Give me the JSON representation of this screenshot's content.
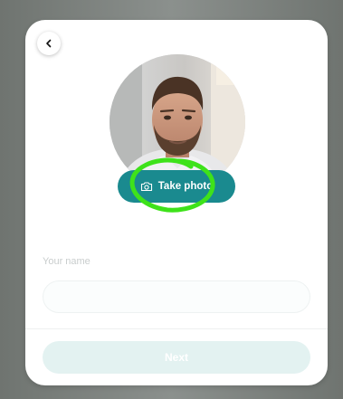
{
  "profile": {
    "take_photo_label": "Take photo",
    "name_label": "Your name",
    "name_value": "",
    "next_label": "Next"
  },
  "icons": {
    "back": "chevron-left-icon",
    "camera": "camera-icon"
  },
  "colors": {
    "accent": "#1a8a8f",
    "next_disabled": "#e3f2f1",
    "highlight": "#3ee21a",
    "label": "#c9cdcd"
  }
}
